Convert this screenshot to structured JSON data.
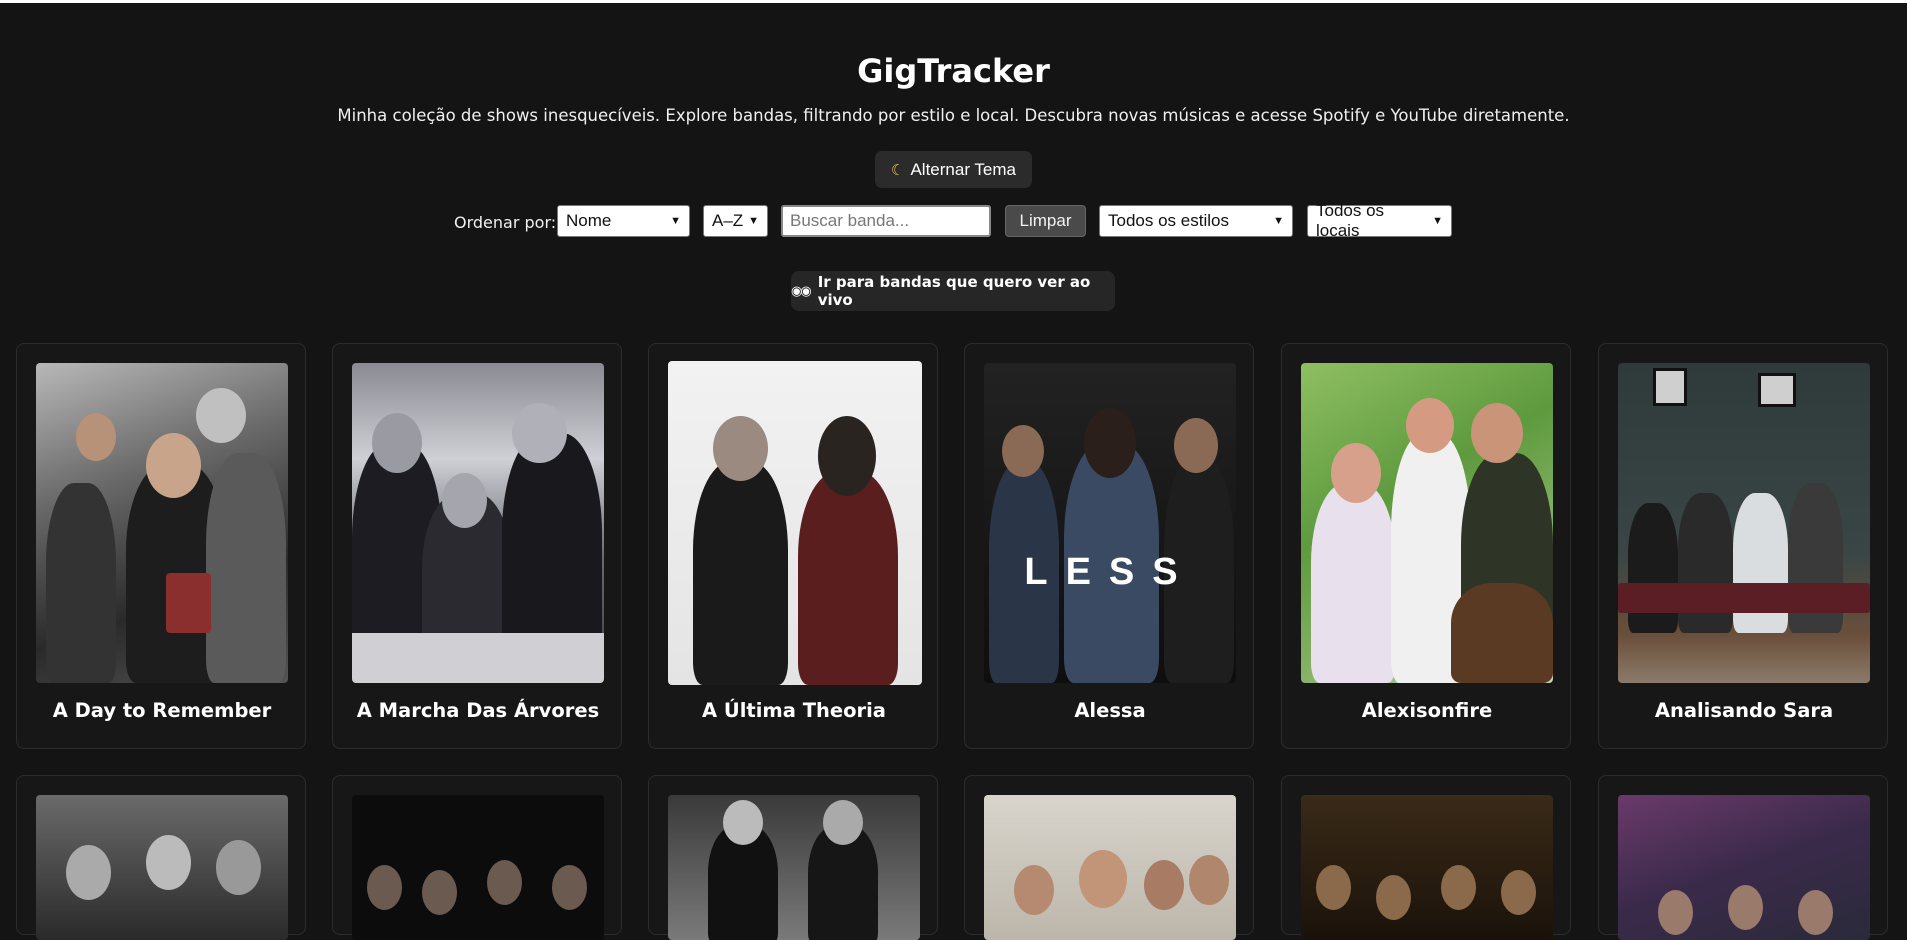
{
  "header": {
    "title": "GigTracker",
    "subtitle": "Minha coleção de shows inesquecíveis. Explore bandas, filtrando por estilo e local. Descubra novas músicas e acesse Spotify e YouTube diretamente.",
    "theme_button": "Alternar Tema",
    "theme_icon": "moon-icon"
  },
  "toolbar": {
    "sort_label": "Ordenar por:",
    "sort_field": "Nome",
    "sort_order": "A–Z",
    "search_placeholder": "Buscar banda...",
    "clear_label": "Limpar",
    "style_filter": "Todos os estilos",
    "location_filter": "Todos os locais"
  },
  "wishlist_button": {
    "icon": "eyes-icon",
    "label": "Ir para bandas que quero ver ao vivo"
  },
  "bands": [
    {
      "name": "A Day to Remember"
    },
    {
      "name": "A Marcha Das Árvores"
    },
    {
      "name": "A Última Theoria"
    },
    {
      "name": "Alessa",
      "logo_text": "LESS"
    },
    {
      "name": "Alexisonfire"
    },
    {
      "name": "Analisando Sara"
    }
  ],
  "colors": {
    "background": "#141414",
    "card_background": "#171717",
    "button_background": "#2b2b2b"
  }
}
